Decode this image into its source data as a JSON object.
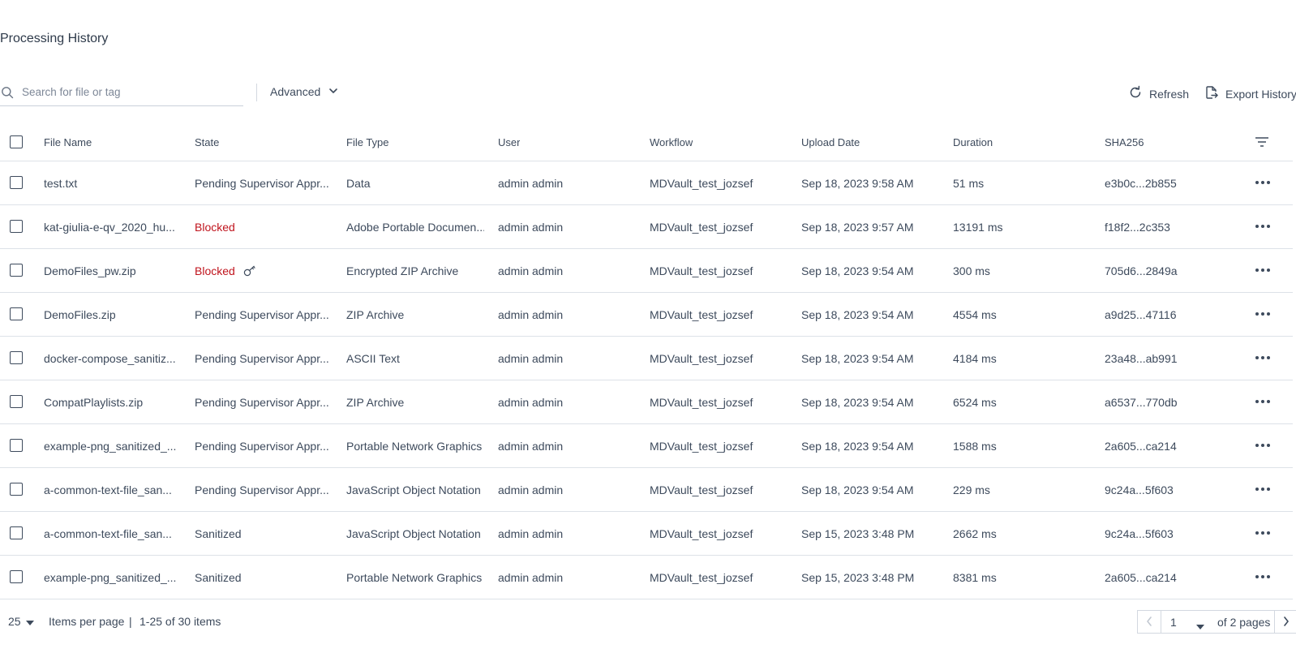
{
  "page": {
    "title": "Processing History"
  },
  "toolbar": {
    "search_placeholder": "Search for file or tag",
    "advanced_label": "Advanced",
    "refresh_label": "Refresh",
    "export_label": "Export History"
  },
  "table": {
    "columns": [
      "File Name",
      "State",
      "File Type",
      "User",
      "Workflow",
      "Upload Date",
      "Duration",
      "SHA256"
    ],
    "rows": [
      {
        "file_name": "test.txt",
        "state": "Pending Supervisor Appr...",
        "state_kind": "normal",
        "encrypted": false,
        "file_type": "Data",
        "user": "admin admin",
        "workflow": "MDVault_test_jozsef",
        "upload_date": "Sep 18, 2023 9:58 AM",
        "duration": "51 ms",
        "sha256": "e3b0c...2b855"
      },
      {
        "file_name": "kat-giulia-e-qv_2020_hu...",
        "state": "Blocked",
        "state_kind": "blocked",
        "encrypted": false,
        "file_type": "Adobe Portable Documen...",
        "user": "admin admin",
        "workflow": "MDVault_test_jozsef",
        "upload_date": "Sep 18, 2023 9:57 AM",
        "duration": "13191 ms",
        "sha256": "f18f2...2c353"
      },
      {
        "file_name": "DemoFiles_pw.zip",
        "state": "Blocked",
        "state_kind": "blocked",
        "encrypted": true,
        "file_type": "Encrypted ZIP Archive",
        "user": "admin admin",
        "workflow": "MDVault_test_jozsef",
        "upload_date": "Sep 18, 2023 9:54 AM",
        "duration": "300 ms",
        "sha256": "705d6...2849a"
      },
      {
        "file_name": "DemoFiles.zip",
        "state": "Pending Supervisor Appr...",
        "state_kind": "normal",
        "encrypted": false,
        "file_type": "ZIP Archive",
        "user": "admin admin",
        "workflow": "MDVault_test_jozsef",
        "upload_date": "Sep 18, 2023 9:54 AM",
        "duration": "4554 ms",
        "sha256": "a9d25...47116"
      },
      {
        "file_name": "docker-compose_sanitiz...",
        "state": "Pending Supervisor Appr...",
        "state_kind": "normal",
        "encrypted": false,
        "file_type": "ASCII Text",
        "user": "admin admin",
        "workflow": "MDVault_test_jozsef",
        "upload_date": "Sep 18, 2023 9:54 AM",
        "duration": "4184 ms",
        "sha256": "23a48...ab991"
      },
      {
        "file_name": "CompatPlaylists.zip",
        "state": "Pending Supervisor Appr...",
        "state_kind": "normal",
        "encrypted": false,
        "file_type": "ZIP Archive",
        "user": "admin admin",
        "workflow": "MDVault_test_jozsef",
        "upload_date": "Sep 18, 2023 9:54 AM",
        "duration": "6524 ms",
        "sha256": "a6537...770db"
      },
      {
        "file_name": "example-png_sanitized_...",
        "state": "Pending Supervisor Appr...",
        "state_kind": "normal",
        "encrypted": false,
        "file_type": "Portable Network Graphics",
        "user": "admin admin",
        "workflow": "MDVault_test_jozsef",
        "upload_date": "Sep 18, 2023 9:54 AM",
        "duration": "1588 ms",
        "sha256": "2a605...ca214"
      },
      {
        "file_name": "a-common-text-file_san...",
        "state": "Pending Supervisor Appr...",
        "state_kind": "normal",
        "encrypted": false,
        "file_type": "JavaScript Object Notation",
        "user": "admin admin",
        "workflow": "MDVault_test_jozsef",
        "upload_date": "Sep 18, 2023 9:54 AM",
        "duration": "229 ms",
        "sha256": "9c24a...5f603"
      },
      {
        "file_name": "a-common-text-file_san...",
        "state": "Sanitized",
        "state_kind": "normal",
        "encrypted": false,
        "file_type": "JavaScript Object Notation",
        "user": "admin admin",
        "workflow": "MDVault_test_jozsef",
        "upload_date": "Sep 15, 2023 3:48 PM",
        "duration": "2662 ms",
        "sha256": "9c24a...5f603"
      },
      {
        "file_name": "example-png_sanitized_...",
        "state": "Sanitized",
        "state_kind": "normal",
        "encrypted": false,
        "file_type": "Portable Network Graphics",
        "user": "admin admin",
        "workflow": "MDVault_test_jozsef",
        "upload_date": "Sep 15, 2023 3:48 PM",
        "duration": "8381 ms",
        "sha256": "2a605...ca214"
      }
    ]
  },
  "pagination": {
    "per_page": "25",
    "per_page_label": "Items per page",
    "separator": "|",
    "range_label": "1-25 of 30 items",
    "current_page": "1",
    "total_label": "of 2 pages"
  },
  "colors": {
    "text": "#3d4a5c",
    "blocked": "#c0141d",
    "border": "#dde2e8"
  },
  "icons": [
    "search-icon",
    "chevron-down-icon",
    "refresh-icon",
    "export-icon",
    "filter-icon",
    "key-icon",
    "more-icon",
    "chevron-left-icon",
    "chevron-right-icon",
    "caret-down-icon"
  ]
}
